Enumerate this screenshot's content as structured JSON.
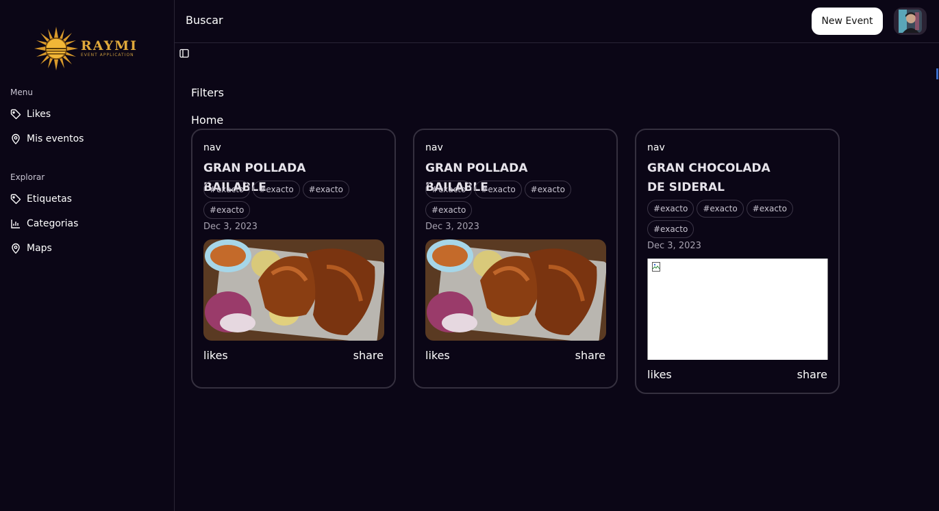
{
  "brand": {
    "title": "RAYMI",
    "subtitle": "EVENT APPLICATION"
  },
  "sidebar": {
    "menu_label": "Menu",
    "menu_items": [
      {
        "label": "Likes",
        "icon": "tag-icon"
      },
      {
        "label": "Mis eventos",
        "icon": "location-pin-icon"
      }
    ],
    "explore_label": "Explorar",
    "explore_items": [
      {
        "label": "Etiquetas",
        "icon": "tag-icon"
      },
      {
        "label": "Categorias",
        "icon": "chart-icon"
      },
      {
        "label": "Maps",
        "icon": "location-pin-icon"
      }
    ]
  },
  "topbar": {
    "search_label": "Buscar",
    "new_event_label": "New Event"
  },
  "main": {
    "filters_label": "Filters",
    "home_label": "Home"
  },
  "cards": [
    {
      "nav": "nav",
      "title": "GRAN POLLADA BAILABLE",
      "tags": [
        "#exacto",
        "#exacto",
        "#exacto",
        "#exacto"
      ],
      "date": "Dec 3, 2023",
      "likes": "likes",
      "share": "share"
    },
    {
      "nav": "nav",
      "title": "GRAN POLLADA BAILABLE",
      "tags": [
        "#exacto",
        "#exacto",
        "#exacto",
        "#exacto"
      ],
      "date": "Dec 3, 2023",
      "likes": "likes",
      "share": "share"
    },
    {
      "nav": "nav",
      "title": "GRAN CHOCOLADA DE SIDERAL",
      "tags": [
        "#exacto",
        "#exacto",
        "#exacto",
        "#exacto"
      ],
      "date": "Dec 3, 2023",
      "likes": "likes",
      "share": "share"
    }
  ],
  "colors": {
    "background": "#0b0616",
    "brand_gold": "#e0a93b",
    "card_border": "#35303f"
  }
}
